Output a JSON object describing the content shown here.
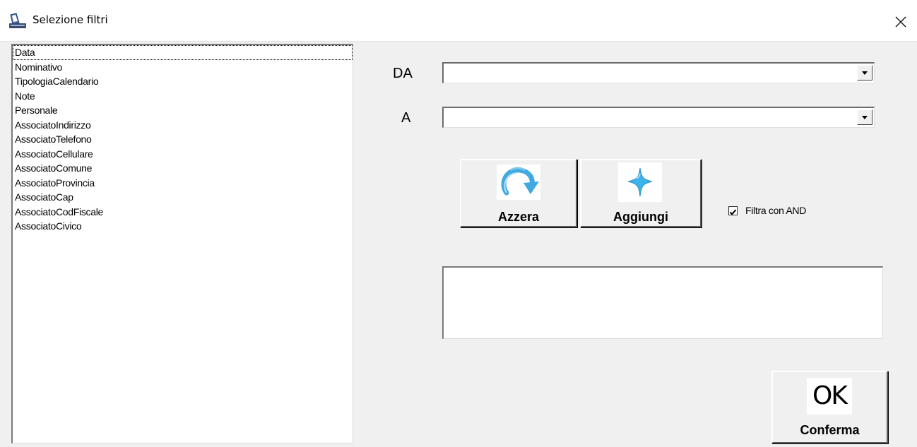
{
  "window": {
    "title": "Selezione filtri",
    "icon": "app-scanner-icon",
    "close_icon": "close-icon"
  },
  "fields_list": {
    "items": [
      {
        "label": "Data",
        "focused": true
      },
      {
        "label": "Nominativo"
      },
      {
        "label": "TipologiaCalendario"
      },
      {
        "label": "Note"
      },
      {
        "label": "Personale"
      },
      {
        "label": "AssociatoIndirizzo"
      },
      {
        "label": "AssociatoTelefono"
      },
      {
        "label": "AssociatoCellulare"
      },
      {
        "label": "AssociatoComune"
      },
      {
        "label": "AssociatoProvincia"
      },
      {
        "label": "AssociatoCap"
      },
      {
        "label": "AssociatoCodFiscale"
      },
      {
        "label": "AssociatoCivico"
      }
    ]
  },
  "range": {
    "from_label": "DA",
    "from_value": "",
    "to_label": "A",
    "to_value": ""
  },
  "buttons": {
    "reset_label": "Azzera",
    "reset_icon": "refresh-arrow-icon",
    "add_label": "Aggiungi",
    "add_icon": "plus-star-icon",
    "confirm_label": "Conferma",
    "confirm_icon_text": "OK"
  },
  "filter_and": {
    "label": "Filtra con AND",
    "checked": true
  },
  "filter_text": {
    "value": ""
  },
  "colors": {
    "window_bg": "#f0f0f0",
    "refresh_icon": "#3fa9e0",
    "plus_icon": "#3cb4ea"
  }
}
